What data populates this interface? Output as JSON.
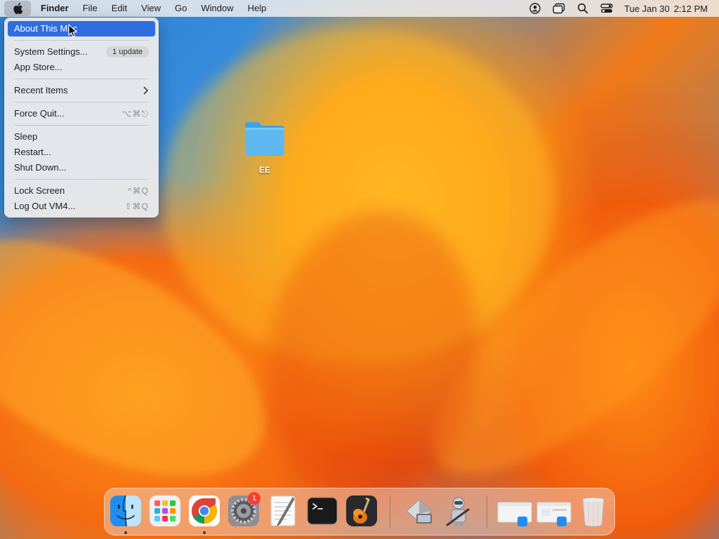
{
  "menubar": {
    "app_name": "Finder",
    "items": [
      "File",
      "Edit",
      "View",
      "Go",
      "Window",
      "Help"
    ],
    "status_icons": [
      "user-icon",
      "window-stack-icon",
      "search-icon",
      "control-center-icon"
    ],
    "clock": {
      "date": "Tue Jan 30",
      "time": "2:12 PM"
    }
  },
  "apple_menu": {
    "items": [
      {
        "label": "About This Mac",
        "selected": true
      },
      {
        "label": "System Settings...",
        "badge": "1 update"
      },
      {
        "label": "App Store..."
      },
      {
        "label": "Recent Items",
        "submenu": true
      },
      {
        "label": "Force Quit...",
        "shortcut": "⌥⌘⎋"
      },
      {
        "label": "Sleep"
      },
      {
        "label": "Restart..."
      },
      {
        "label": "Shut Down..."
      },
      {
        "label": "Lock Screen",
        "shortcut": "^⌘Q"
      },
      {
        "label": "Log Out VM4...",
        "shortcut": "⇧⌘Q"
      }
    ]
  },
  "desktop": {
    "folder_name": "EE"
  },
  "dock": {
    "apps": [
      {
        "name": "finder",
        "running": true
      },
      {
        "name": "launchpad",
        "running": false
      },
      {
        "name": "chrome",
        "running": true
      },
      {
        "name": "system-settings",
        "running": false,
        "badge": "1"
      },
      {
        "name": "textedit",
        "running": false
      },
      {
        "name": "terminal",
        "running": false
      },
      {
        "name": "garageband",
        "running": false
      },
      {
        "name": "migration-assistant",
        "running": false
      },
      {
        "name": "automator",
        "running": false
      },
      {
        "name": "finder-window-minimized-1",
        "running": false
      },
      {
        "name": "finder-window-minimized-2",
        "running": false
      },
      {
        "name": "trash",
        "running": false
      }
    ]
  },
  "colors": {
    "menu_highlight": "#2f6de0",
    "badge_red": "#ff3b30",
    "folder_blue": "#5db8ef"
  }
}
